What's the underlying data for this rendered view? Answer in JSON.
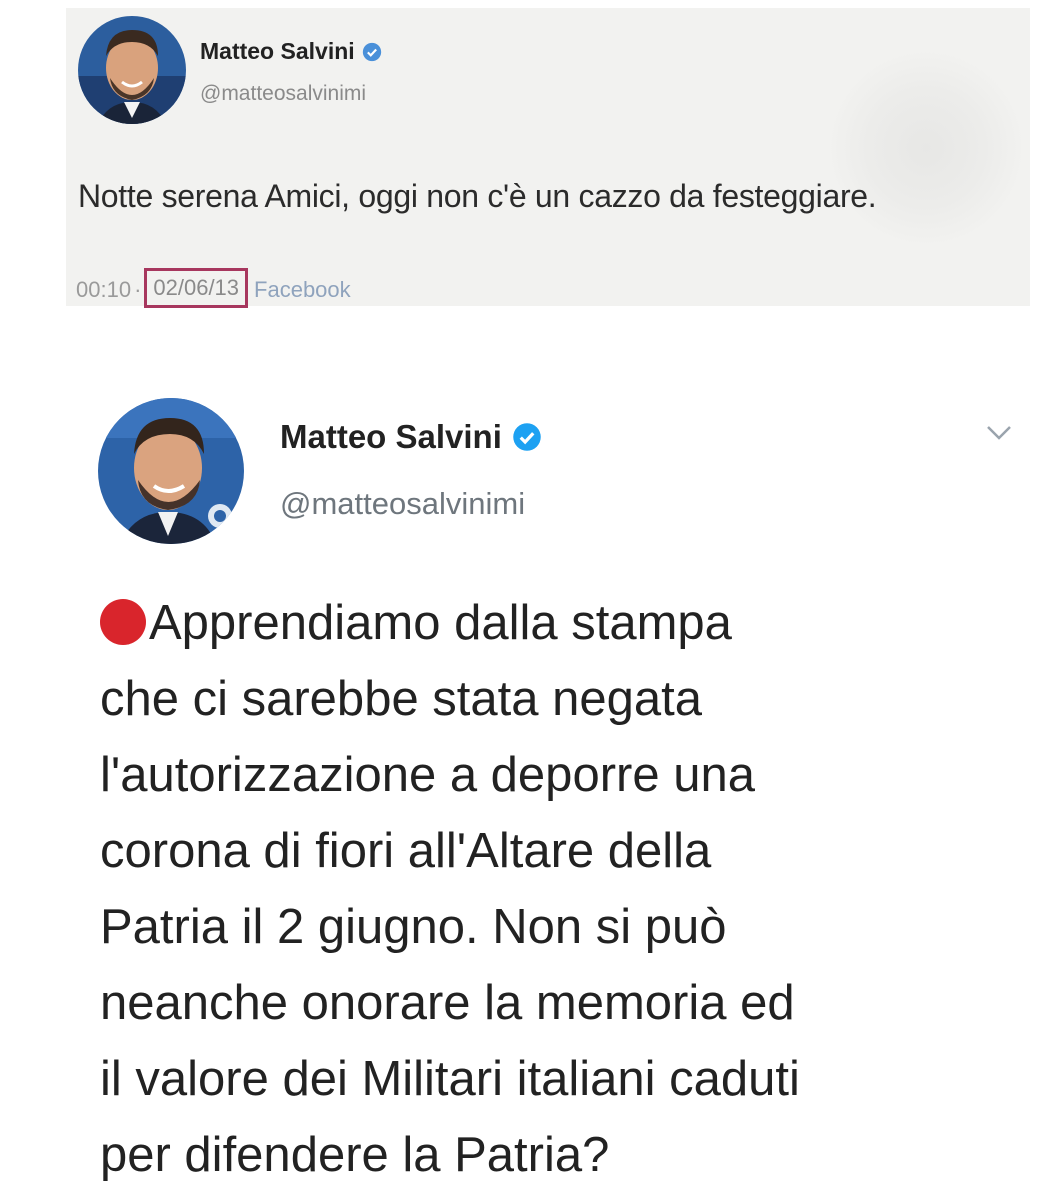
{
  "tweet_top": {
    "author_name": "Matteo Salvini",
    "handle": "@matteosalvinimi",
    "text": "Notte serena Amici, oggi non c'è un cazzo da festeggiare.",
    "time": "00:10",
    "separator": "·",
    "date": "02/06/13",
    "source": "Facebook",
    "highlight_color": "#a7375e"
  },
  "tweet_bottom": {
    "author_name": "Matteo Salvini",
    "handle": "@matteosalvinimi",
    "lines": [
      "Apprendiamo dalla stampa",
      "che ci sarebbe stata negata",
      "l'autorizzazione a deporre una",
      "corona di fiori all'Altare della",
      "Patria il 2 giugno. Non si può",
      "neanche onorare la memoria ed",
      "il valore dei Militari italiani caduti",
      "per difendere la Patria?"
    ],
    "bullet_icon": "red-circle-emoji",
    "bullet_color": "#d9252c",
    "verified_color": "#1da1f2"
  }
}
